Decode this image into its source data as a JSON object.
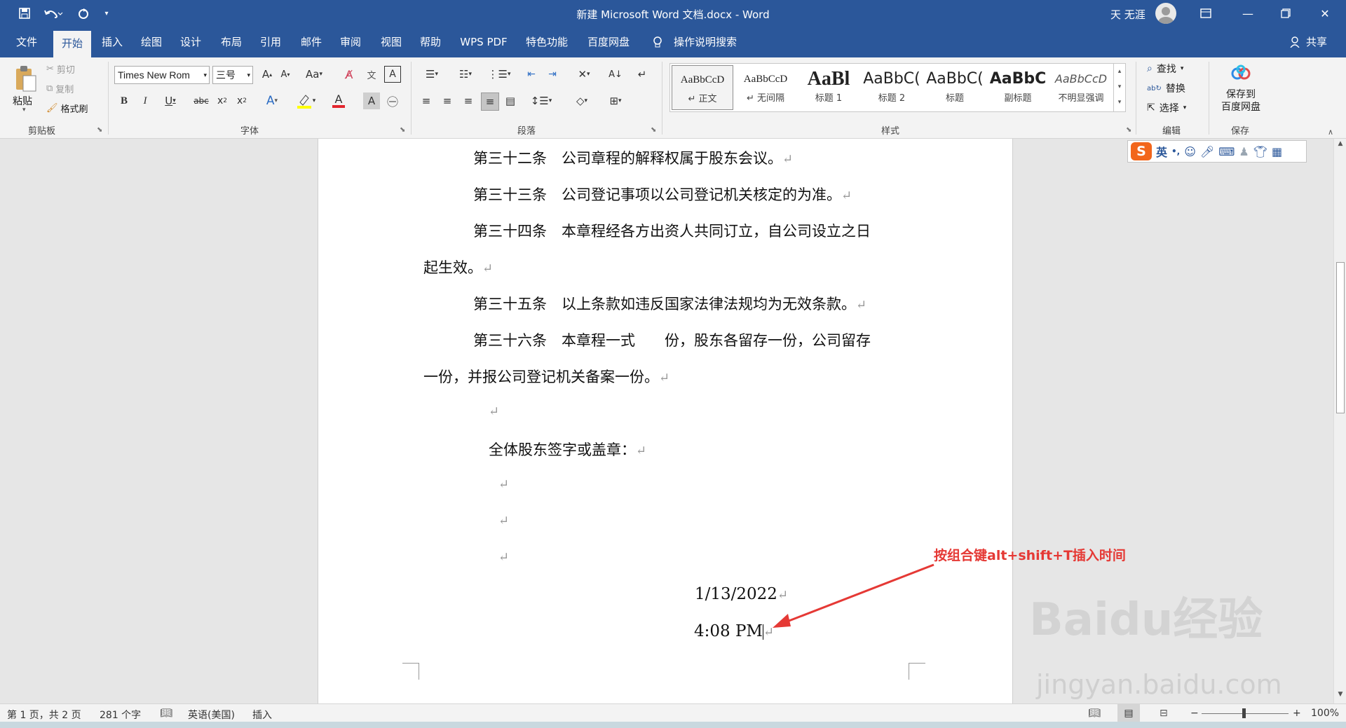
{
  "window": {
    "title": "新建 Microsoft Word 文档.docx  -  Word",
    "user": "天 无涯"
  },
  "tabs": [
    "文件",
    "开始",
    "插入",
    "绘图",
    "设计",
    "布局",
    "引用",
    "邮件",
    "审阅",
    "视图",
    "帮助",
    "WPS PDF",
    "特色功能",
    "百度网盘",
    "操作说明搜索",
    "共享"
  ],
  "clipboard": {
    "paste": "粘贴",
    "cut": "剪切",
    "copy": "复制",
    "format_painter": "格式刷",
    "label": "剪贴板"
  },
  "font": {
    "name": "Times New Rom",
    "size": "三号",
    "label": "字体"
  },
  "paragraph": {
    "label": "段落"
  },
  "styles": {
    "label": "样式",
    "items": [
      {
        "sample": "AaBbCcD",
        "name": "↵ 正文"
      },
      {
        "sample": "AaBbCcD",
        "name": "↵ 无间隔"
      },
      {
        "sample": "AaBl",
        "name": "标题 1"
      },
      {
        "sample": "AaBbC(",
        "name": "标题 2"
      },
      {
        "sample": "AaBbC(",
        "name": "标题"
      },
      {
        "sample": "AaBbC",
        "name": "副标题"
      },
      {
        "sample": "AaBbCcD",
        "name": "不明显强调"
      }
    ]
  },
  "editing": {
    "find": "查找",
    "replace": "替换",
    "select": "选择",
    "label": "编辑"
  },
  "save": {
    "baidu": "保存到",
    "baidu2": "百度网盘",
    "label": "保存"
  },
  "document": {
    "lines": [
      "第三十二条　公司章程的解释权属于股东会议。",
      "第三十三条　公司登记事项以公司登记机关核定的为准。",
      "第三十四条　本章程经各方出资人共同订立，自公司设立之日",
      "起生效。",
      "第三十五条　以上条款如违反国家法律法规均为无效条款。",
      "第三十六条　本章程一式　　份，股东各留存一份，公司留存",
      "一份，并报公司登记机关备案一份。",
      "",
      "全体股东签字或盖章：",
      "",
      "",
      "",
      "1/13/2022",
      "4:08 PM"
    ],
    "para_mark": "↵"
  },
  "ime": {
    "logo": "S",
    "mode": "英"
  },
  "annotation": "按组合键alt+shift+T插入时间",
  "watermark": {
    "brand": "Baidu经验",
    "url": "jingyan.baidu.com"
  },
  "status": {
    "page": "第 1 页，共 2 页",
    "words": "281 个字",
    "lang": "英语(美国)",
    "mode": "插入",
    "zoom": "100%"
  }
}
